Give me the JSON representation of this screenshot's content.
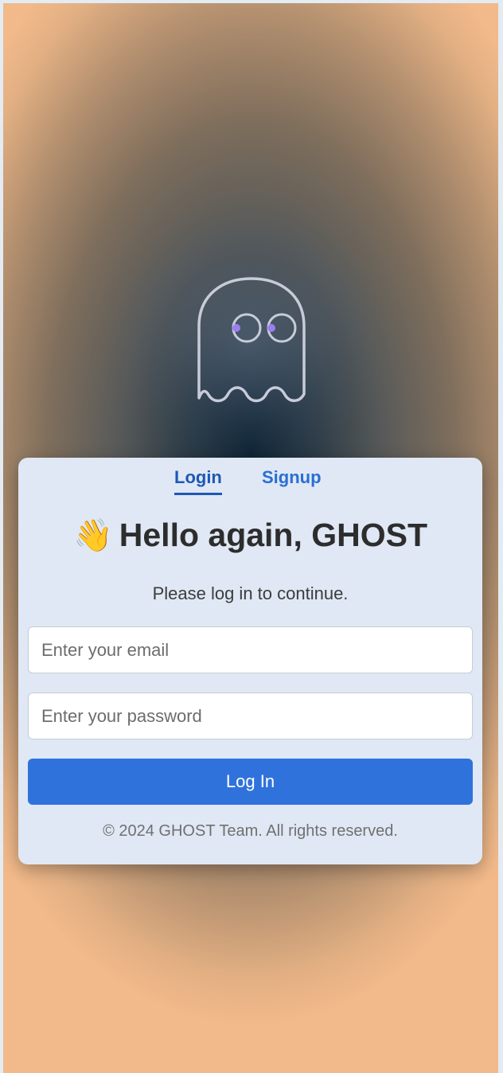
{
  "tabs": {
    "login_label": "Login",
    "signup_label": "Signup"
  },
  "heading": {
    "icon": "waving-hand-icon",
    "icon_glyph": "👋",
    "text": "Hello again, GHOST"
  },
  "subtitle": "Please log in to continue.",
  "form": {
    "email_placeholder": "Enter your email",
    "email_value": "",
    "password_placeholder": "Enter your password",
    "password_value": "",
    "submit_label": "Log In"
  },
  "footer": "© 2024 GHOST Team. All rights reserved.",
  "colors": {
    "accent": "#2f72dc",
    "active_tab": "#1e58b4",
    "card_bg": "#dfe8f4",
    "heading_text": "#2d2d2d"
  }
}
